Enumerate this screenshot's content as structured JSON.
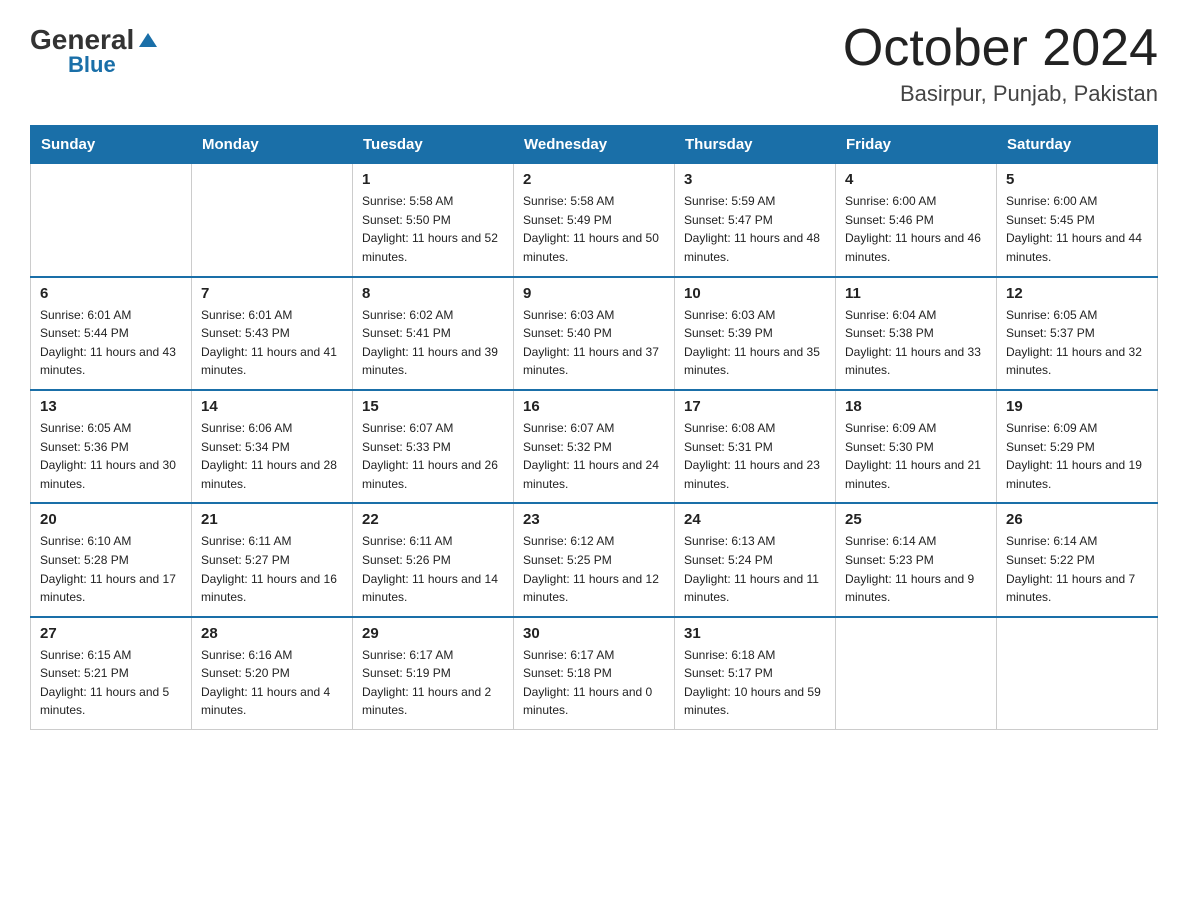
{
  "header": {
    "logo_general": "General",
    "logo_blue": "Blue",
    "month_title": "October 2024",
    "location": "Basirpur, Punjab, Pakistan"
  },
  "weekdays": [
    "Sunday",
    "Monday",
    "Tuesday",
    "Wednesday",
    "Thursday",
    "Friday",
    "Saturday"
  ],
  "weeks": [
    [
      {
        "day": "",
        "sunrise": "",
        "sunset": "",
        "daylight": ""
      },
      {
        "day": "",
        "sunrise": "",
        "sunset": "",
        "daylight": ""
      },
      {
        "day": "1",
        "sunrise": "Sunrise: 5:58 AM",
        "sunset": "Sunset: 5:50 PM",
        "daylight": "Daylight: 11 hours and 52 minutes."
      },
      {
        "day": "2",
        "sunrise": "Sunrise: 5:58 AM",
        "sunset": "Sunset: 5:49 PM",
        "daylight": "Daylight: 11 hours and 50 minutes."
      },
      {
        "day": "3",
        "sunrise": "Sunrise: 5:59 AM",
        "sunset": "Sunset: 5:47 PM",
        "daylight": "Daylight: 11 hours and 48 minutes."
      },
      {
        "day": "4",
        "sunrise": "Sunrise: 6:00 AM",
        "sunset": "Sunset: 5:46 PM",
        "daylight": "Daylight: 11 hours and 46 minutes."
      },
      {
        "day": "5",
        "sunrise": "Sunrise: 6:00 AM",
        "sunset": "Sunset: 5:45 PM",
        "daylight": "Daylight: 11 hours and 44 minutes."
      }
    ],
    [
      {
        "day": "6",
        "sunrise": "Sunrise: 6:01 AM",
        "sunset": "Sunset: 5:44 PM",
        "daylight": "Daylight: 11 hours and 43 minutes."
      },
      {
        "day": "7",
        "sunrise": "Sunrise: 6:01 AM",
        "sunset": "Sunset: 5:43 PM",
        "daylight": "Daylight: 11 hours and 41 minutes."
      },
      {
        "day": "8",
        "sunrise": "Sunrise: 6:02 AM",
        "sunset": "Sunset: 5:41 PM",
        "daylight": "Daylight: 11 hours and 39 minutes."
      },
      {
        "day": "9",
        "sunrise": "Sunrise: 6:03 AM",
        "sunset": "Sunset: 5:40 PM",
        "daylight": "Daylight: 11 hours and 37 minutes."
      },
      {
        "day": "10",
        "sunrise": "Sunrise: 6:03 AM",
        "sunset": "Sunset: 5:39 PM",
        "daylight": "Daylight: 11 hours and 35 minutes."
      },
      {
        "day": "11",
        "sunrise": "Sunrise: 6:04 AM",
        "sunset": "Sunset: 5:38 PM",
        "daylight": "Daylight: 11 hours and 33 minutes."
      },
      {
        "day": "12",
        "sunrise": "Sunrise: 6:05 AM",
        "sunset": "Sunset: 5:37 PM",
        "daylight": "Daylight: 11 hours and 32 minutes."
      }
    ],
    [
      {
        "day": "13",
        "sunrise": "Sunrise: 6:05 AM",
        "sunset": "Sunset: 5:36 PM",
        "daylight": "Daylight: 11 hours and 30 minutes."
      },
      {
        "day": "14",
        "sunrise": "Sunrise: 6:06 AM",
        "sunset": "Sunset: 5:34 PM",
        "daylight": "Daylight: 11 hours and 28 minutes."
      },
      {
        "day": "15",
        "sunrise": "Sunrise: 6:07 AM",
        "sunset": "Sunset: 5:33 PM",
        "daylight": "Daylight: 11 hours and 26 minutes."
      },
      {
        "day": "16",
        "sunrise": "Sunrise: 6:07 AM",
        "sunset": "Sunset: 5:32 PM",
        "daylight": "Daylight: 11 hours and 24 minutes."
      },
      {
        "day": "17",
        "sunrise": "Sunrise: 6:08 AM",
        "sunset": "Sunset: 5:31 PM",
        "daylight": "Daylight: 11 hours and 23 minutes."
      },
      {
        "day": "18",
        "sunrise": "Sunrise: 6:09 AM",
        "sunset": "Sunset: 5:30 PM",
        "daylight": "Daylight: 11 hours and 21 minutes."
      },
      {
        "day": "19",
        "sunrise": "Sunrise: 6:09 AM",
        "sunset": "Sunset: 5:29 PM",
        "daylight": "Daylight: 11 hours and 19 minutes."
      }
    ],
    [
      {
        "day": "20",
        "sunrise": "Sunrise: 6:10 AM",
        "sunset": "Sunset: 5:28 PM",
        "daylight": "Daylight: 11 hours and 17 minutes."
      },
      {
        "day": "21",
        "sunrise": "Sunrise: 6:11 AM",
        "sunset": "Sunset: 5:27 PM",
        "daylight": "Daylight: 11 hours and 16 minutes."
      },
      {
        "day": "22",
        "sunrise": "Sunrise: 6:11 AM",
        "sunset": "Sunset: 5:26 PM",
        "daylight": "Daylight: 11 hours and 14 minutes."
      },
      {
        "day": "23",
        "sunrise": "Sunrise: 6:12 AM",
        "sunset": "Sunset: 5:25 PM",
        "daylight": "Daylight: 11 hours and 12 minutes."
      },
      {
        "day": "24",
        "sunrise": "Sunrise: 6:13 AM",
        "sunset": "Sunset: 5:24 PM",
        "daylight": "Daylight: 11 hours and 11 minutes."
      },
      {
        "day": "25",
        "sunrise": "Sunrise: 6:14 AM",
        "sunset": "Sunset: 5:23 PM",
        "daylight": "Daylight: 11 hours and 9 minutes."
      },
      {
        "day": "26",
        "sunrise": "Sunrise: 6:14 AM",
        "sunset": "Sunset: 5:22 PM",
        "daylight": "Daylight: 11 hours and 7 minutes."
      }
    ],
    [
      {
        "day": "27",
        "sunrise": "Sunrise: 6:15 AM",
        "sunset": "Sunset: 5:21 PM",
        "daylight": "Daylight: 11 hours and 5 minutes."
      },
      {
        "day": "28",
        "sunrise": "Sunrise: 6:16 AM",
        "sunset": "Sunset: 5:20 PM",
        "daylight": "Daylight: 11 hours and 4 minutes."
      },
      {
        "day": "29",
        "sunrise": "Sunrise: 6:17 AM",
        "sunset": "Sunset: 5:19 PM",
        "daylight": "Daylight: 11 hours and 2 minutes."
      },
      {
        "day": "30",
        "sunrise": "Sunrise: 6:17 AM",
        "sunset": "Sunset: 5:18 PM",
        "daylight": "Daylight: 11 hours and 0 minutes."
      },
      {
        "day": "31",
        "sunrise": "Sunrise: 6:18 AM",
        "sunset": "Sunset: 5:17 PM",
        "daylight": "Daylight: 10 hours and 59 minutes."
      },
      {
        "day": "",
        "sunrise": "",
        "sunset": "",
        "daylight": ""
      },
      {
        "day": "",
        "sunrise": "",
        "sunset": "",
        "daylight": ""
      }
    ]
  ]
}
